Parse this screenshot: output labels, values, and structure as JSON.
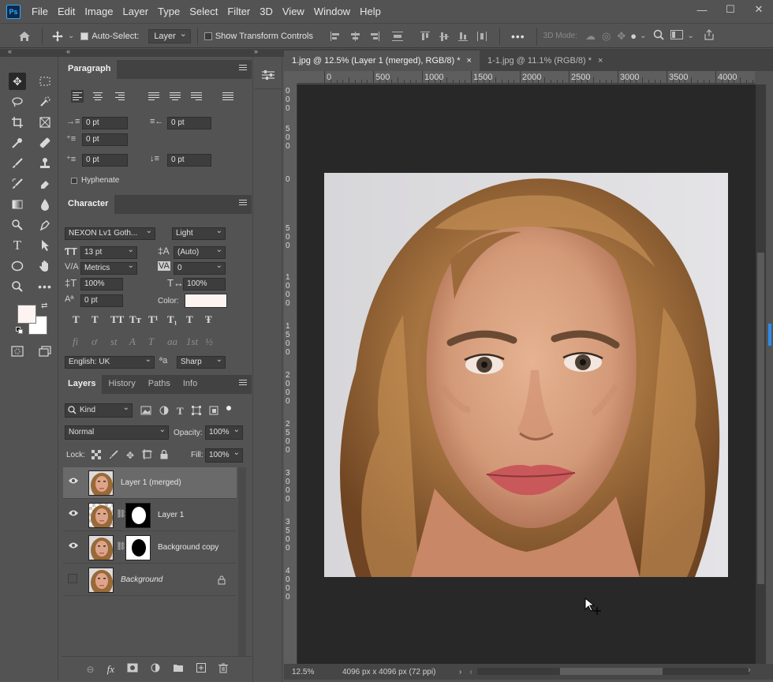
{
  "app": {
    "logo_text": "Ps",
    "menu": [
      "File",
      "Edit",
      "Image",
      "Layer",
      "Type",
      "Select",
      "Filter",
      "3D",
      "View",
      "Window",
      "Help"
    ],
    "window_controls": {
      "minimize": "—",
      "maximize": "☐",
      "close": "✕"
    }
  },
  "options_bar": {
    "auto_select_label": "Auto-Select:",
    "auto_select_checked": true,
    "auto_select_target": "Layer",
    "show_transform_label": "Show Transform Controls",
    "show_transform_checked": false,
    "mode_3d_label": "3D Mode:"
  },
  "paragraph_panel": {
    "title": "Paragraph",
    "indent_left": "0 pt",
    "indent_right": "0 pt",
    "indent_first": "0 pt",
    "space_before": "0 pt",
    "space_after": "0 pt",
    "hyphenate_label": "Hyphenate",
    "hyphenate_checked": false
  },
  "character_panel": {
    "title": "Character",
    "font_family": "NEXON Lv1 Goth...",
    "font_style": "Light",
    "font_size": "13 pt",
    "leading": "(Auto)",
    "kerning": "Metrics",
    "tracking": "0",
    "vertical_scale": "100%",
    "horizontal_scale": "100%",
    "baseline_shift": "0 pt",
    "color_label": "Color:",
    "text_color": "#fdf4f2",
    "style_buttons": [
      "T",
      "T",
      "TT",
      "Tт",
      "T¹",
      "T₁",
      "T",
      "Ŧ"
    ],
    "opentype_buttons": [
      "fi",
      "ơ",
      "st",
      "A",
      "T",
      "aa",
      "1st",
      "½"
    ],
    "language": "English: UK",
    "aa_label": "ªa",
    "antialias": "Sharp"
  },
  "layers_panel": {
    "tabs": [
      "Layers",
      "History",
      "Paths",
      "Info"
    ],
    "filter_kind": "Kind",
    "blend_mode": "Normal",
    "opacity_label": "Opacity:",
    "opacity": "100%",
    "lock_label": "Lock:",
    "fill_label": "Fill:",
    "fill": "100%",
    "layers": [
      {
        "name": "Layer 1 (merged)",
        "visible": true,
        "selected": true
      },
      {
        "name": "Layer 1",
        "visible": true,
        "selected": false
      },
      {
        "name": "Background copy",
        "visible": true,
        "selected": false
      },
      {
        "name": "Background",
        "visible": false,
        "selected": false,
        "locked": true
      }
    ],
    "footer_icons": [
      "link-icon",
      "fx-icon",
      "mask-icon",
      "adjustment-icon",
      "folder-icon",
      "new-layer-icon",
      "trash-icon"
    ]
  },
  "documents": {
    "tabs": [
      {
        "label": "1.jpg @ 12.5% (Layer 1 (merged), RGB/8) *",
        "active": true
      },
      {
        "label": "1-1.jpg @ 11.1% (RGB/8) *",
        "active": false
      }
    ],
    "ruler_h": [
      "0",
      "500",
      "1000",
      "1500",
      "2000",
      "2500",
      "3000",
      "3500",
      "4000"
    ],
    "ruler_v": [
      "0\n0\n0",
      "5\n0\n0",
      "0",
      "5\n0\n0",
      "1\n0\n0\n0",
      "1\n5\n0\n0",
      "2\n0\n0\n0",
      "2\n5\n0\n0",
      "3\n0\n0\n0",
      "3\n5\n0\n0",
      "4\n0\n0\n0"
    ],
    "zoom": "12.5%",
    "doc_info": "4096 px x 4096 px (72 ppi)"
  },
  "colors": {
    "foreground": "#fdf4f2",
    "background": "#ffffff",
    "accent": "#31a8ff"
  }
}
